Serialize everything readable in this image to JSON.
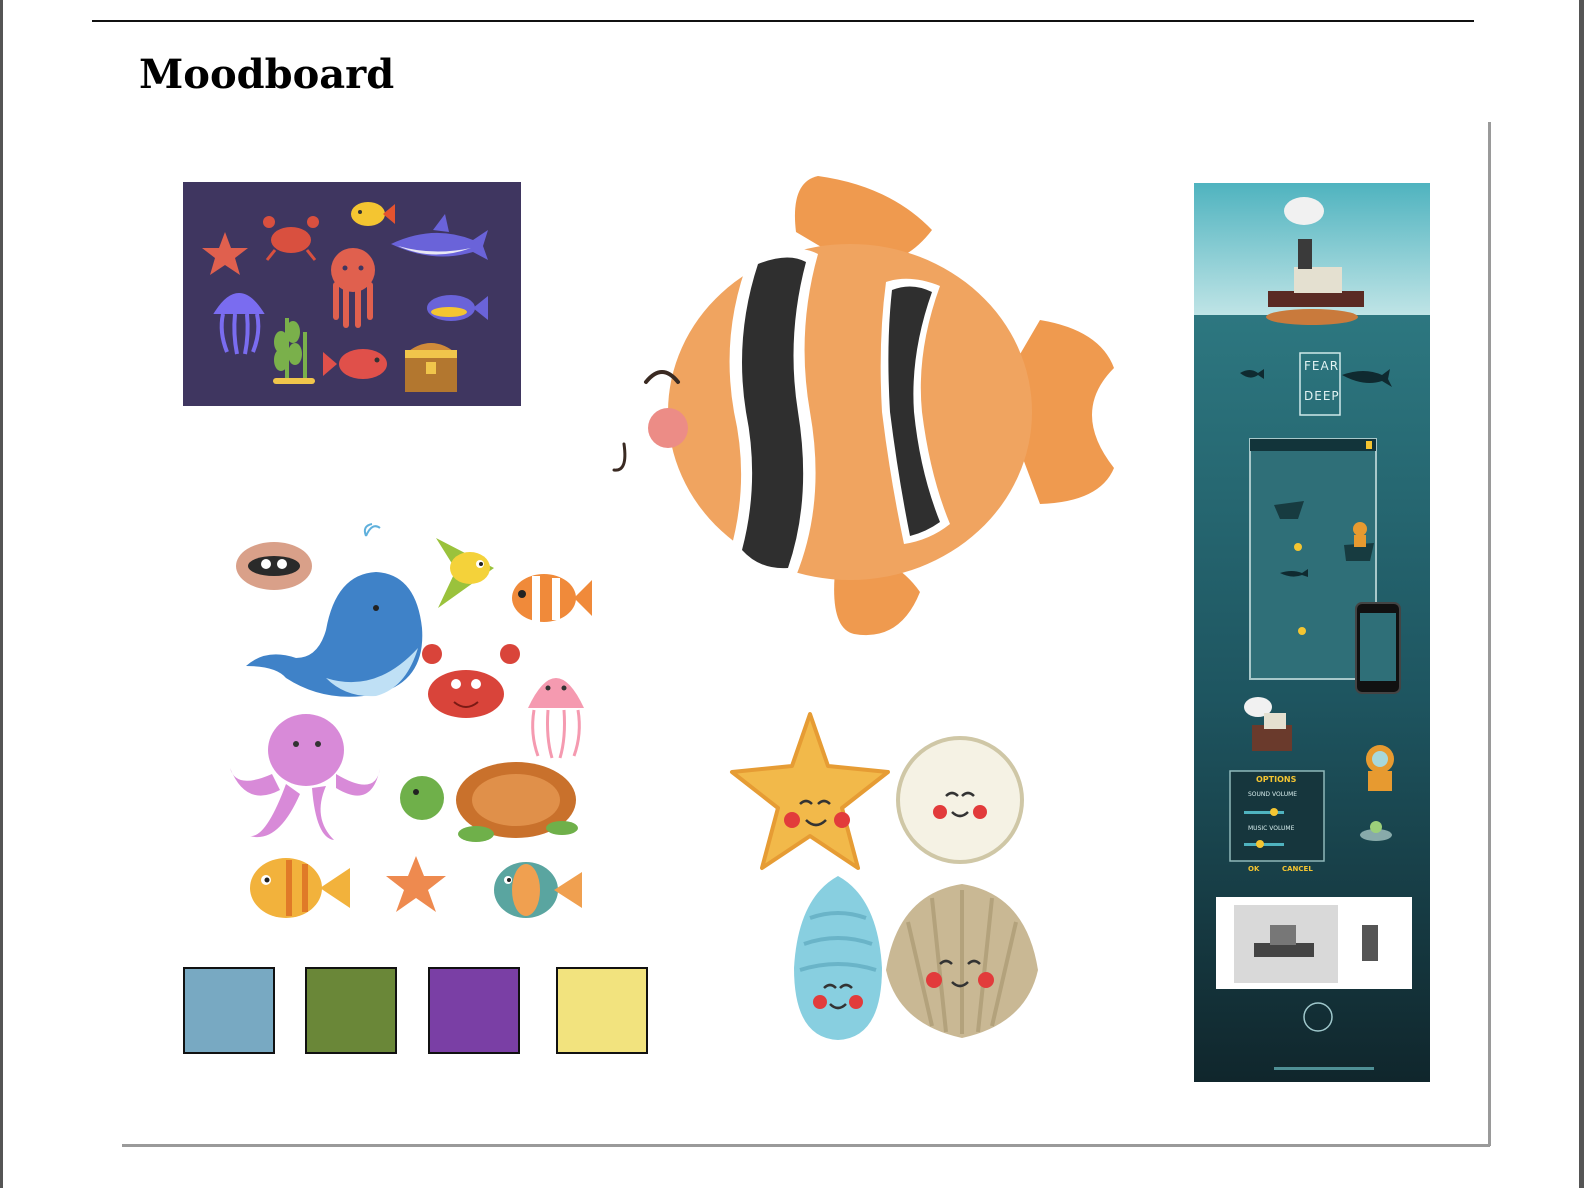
{
  "document": {
    "title": "Moodboard"
  },
  "palette": {
    "swatches": [
      {
        "color": "#78a9c2"
      },
      {
        "color": "#6a8738"
      },
      {
        "color": "#7a3fa5"
      },
      {
        "color": "#f2e37e"
      }
    ]
  },
  "poster": {
    "logo_line1": "FEAR",
    "logo_line2": "DEEP",
    "options_title": "OPTIONS",
    "sound_label": "SOUND VOLUME",
    "music_label": "MUSIC VOLUME",
    "ok_label": "OK",
    "cancel_label": "CANCEL"
  }
}
